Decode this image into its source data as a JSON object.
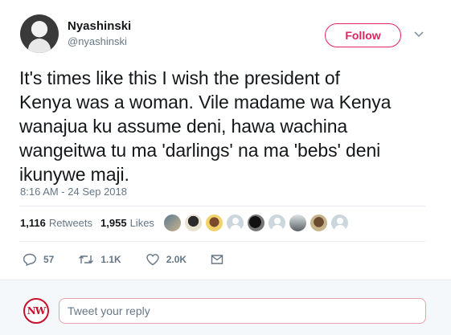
{
  "author": {
    "name": "Nyashinski",
    "handle": "@nyashinski"
  },
  "follow_label": "Follow",
  "tweet_lines": [
    "It's times like this I wish the president of",
    "Kenya was a woman. Vile madame wa Kenya",
    "wanajua ku assume deni, hawa wachina",
    "wangeitwa tu ma 'darlings' na ma 'bebs' deni",
    "ikunywe maji."
  ],
  "timestamp": "8:16 AM - 24 Sep 2018",
  "stats": {
    "retweets_count": "1,116",
    "retweets_label": "Retweets",
    "likes_count": "1,955",
    "likes_label": "Likes"
  },
  "actions": {
    "reply_count": "57",
    "retweet_count": "1.1K",
    "like_count": "2.0K"
  },
  "reply": {
    "placeholder": "Tweet your reply",
    "avatar_text": "NW"
  },
  "colors": {
    "follow_accent": "#e0245e",
    "muted_text": "#657786",
    "primary_text": "#14171a"
  }
}
